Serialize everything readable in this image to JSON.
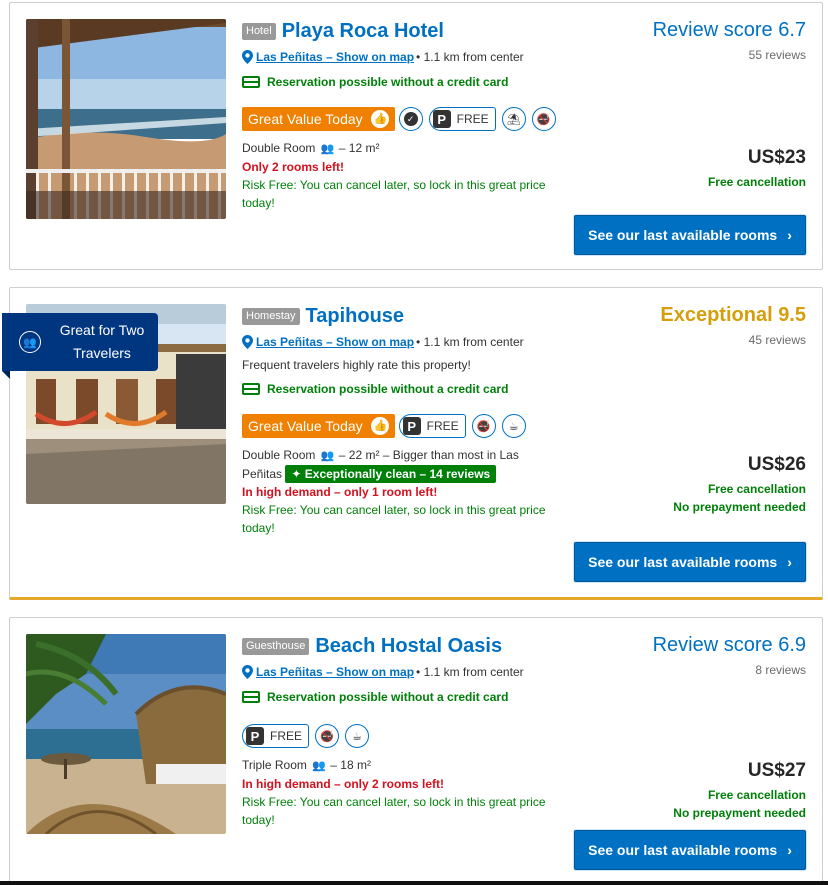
{
  "listings": [
    {
      "type": "Hotel",
      "name": "Playa Roca Hotel",
      "location": "Las Peñitas – Show on map",
      "distance": "• 1.1 km from center",
      "reservation": "Reservation possible without a credit card",
      "deal": "Great Value Today",
      "parking": "FREE",
      "room": "Double Room",
      "room_detail": "– 12 m²",
      "warning": "Only 2 rooms left!",
      "risk": "Risk Free: You can cancel later, so lock in this great price today!",
      "score_label": "Review score 6.7",
      "reviews": "55 reviews",
      "price": "US$23",
      "cancellation": "Free cancellation",
      "cta": "See our last available rooms"
    },
    {
      "type": "Homestay",
      "name": "Tapihouse",
      "location": "Las Peñitas – Show on map",
      "distance": "• 1.1 km from center",
      "frequent": "Frequent travelers highly rate this property!",
      "reservation": "Reservation possible without a credit card",
      "deal": "Great Value Today",
      "parking": "FREE",
      "room": "Double Room",
      "room_detail": "– 22 m² – Bigger than most in Las Peñitas",
      "clean": "Exceptionally clean – 14 reviews",
      "warning": "In high demand – only 1 room left!",
      "risk": "Risk Free: You can cancel later, so lock in this great price today!",
      "score_label": "Exceptional 9.5",
      "reviews": "45 reviews",
      "price": "US$26",
      "cancellation": "Free cancellation",
      "prepayment": "No prepayment needed",
      "cta": "See our last available rooms",
      "ribbon": "Great for Two Travelers"
    },
    {
      "type": "Guesthouse",
      "name": "Beach Hostal Oasis",
      "location": "Las Peñitas – Show on map",
      "distance": "• 1.1 km from center",
      "reservation": "Reservation possible without a credit card",
      "parking": "FREE",
      "room": "Triple Room",
      "room_detail": "– 18 m²",
      "warning": "In high demand – only 2 rooms left!",
      "risk": "Risk Free: You can cancel later, so lock in this great price today!",
      "score_label": "Review score 6.9",
      "reviews": "8 reviews",
      "price": "US$27",
      "cancellation": "Free cancellation",
      "prepayment": "No prepayment needed",
      "cta": "See our last available rooms"
    }
  ],
  "colors": {
    "link": "#0071c2",
    "green": "#008009",
    "red": "#d4111e",
    "deal": "#f08000",
    "exceptional": "#d59e0b",
    "ribbon": "#003580"
  },
  "icons": [
    "map-pin-icon",
    "credit-card-icon",
    "thumbs-up-icon",
    "check-badge-icon",
    "parking-icon",
    "beach-icon",
    "no-smoking-icon",
    "coffee-icon",
    "couple-icon",
    "sparkle-icon",
    "chevron-right-icon"
  ]
}
